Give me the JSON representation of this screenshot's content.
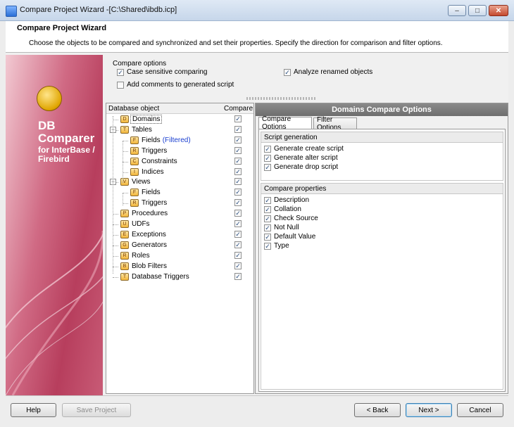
{
  "window": {
    "title": "Compare Project Wizard -[C:\\Shared\\ibdb.icp]",
    "controls": {
      "minimize": "–",
      "maximize": "□",
      "close": "✕"
    }
  },
  "header": {
    "title": "Compare Project Wizard",
    "description": "Choose the objects to be compared and synchronized and set their properties. Specify the direction for comparison and filter options."
  },
  "banner": {
    "product_line1": "DB",
    "product_line2": "Comparer",
    "product_sub": "for InterBase / Firebird",
    "logo_icon": "scales-icon"
  },
  "compare_options": {
    "legend": "Compare options",
    "case_sensitive": {
      "label": "Case sensitive comparing",
      "checked": true
    },
    "analyze_renamed": {
      "label": "Analyze renamed objects",
      "checked": true
    },
    "add_comments": {
      "label": "Add comments to generated script",
      "checked": false
    }
  },
  "tree": {
    "col_object": "Database object",
    "col_compare": "Compare",
    "nodes": [
      {
        "label": "Domains",
        "level": 0,
        "expander": "",
        "icon": "D",
        "selected": true,
        "checked": true
      },
      {
        "label": "Tables",
        "level": 0,
        "expander": "−",
        "icon": "T",
        "checked": true
      },
      {
        "label": "Fields",
        "suffix": "(Filtered)",
        "level": 1,
        "icon": "F",
        "checked": true
      },
      {
        "label": "Triggers",
        "level": 1,
        "icon": "R",
        "checked": true
      },
      {
        "label": "Constraints",
        "level": 1,
        "icon": "C",
        "checked": true
      },
      {
        "label": "Indices",
        "level": 1,
        "icon": "I",
        "checked": true
      },
      {
        "label": "Views",
        "level": 0,
        "expander": "−",
        "icon": "V",
        "checked": true
      },
      {
        "label": "Fields",
        "level": 1,
        "icon": "F",
        "checked": true
      },
      {
        "label": "Triggers",
        "level": 1,
        "icon": "R",
        "checked": true
      },
      {
        "label": "Procedures",
        "level": 0,
        "icon": "P",
        "checked": true
      },
      {
        "label": "UDFs",
        "level": 0,
        "icon": "U",
        "checked": true
      },
      {
        "label": "Exceptions",
        "level": 0,
        "icon": "E",
        "checked": true
      },
      {
        "label": "Generators",
        "level": 0,
        "icon": "G",
        "checked": true
      },
      {
        "label": "Roles",
        "level": 0,
        "icon": "R",
        "checked": true
      },
      {
        "label": "Blob Filters",
        "level": 0,
        "icon": "B",
        "checked": true
      },
      {
        "label": "Database Triggers",
        "level": 0,
        "icon": "T",
        "checked": true
      }
    ]
  },
  "options_panel": {
    "title": "Domains Compare Options",
    "tabs": [
      "Compare Options",
      "Filter Options"
    ],
    "active_tab": "Compare Options",
    "script_generation": {
      "header": "Script generation",
      "items": [
        {
          "label": "Generate create script",
          "checked": true
        },
        {
          "label": "Generate alter script",
          "checked": true
        },
        {
          "label": "Generate drop script",
          "checked": true
        }
      ]
    },
    "compare_properties": {
      "header": "Compare properties",
      "items": [
        {
          "label": "Description",
          "checked": true
        },
        {
          "label": "Collation",
          "checked": true
        },
        {
          "label": "Check Source",
          "checked": true
        },
        {
          "label": "Not Null",
          "checked": true
        },
        {
          "label": "Default Value",
          "checked": true
        },
        {
          "label": "Type",
          "checked": true
        }
      ]
    }
  },
  "buttons": {
    "help": "Help",
    "save_project": "Save Project",
    "back": "< Back",
    "next": "Next >",
    "cancel": "Cancel"
  },
  "check_mark": "✓"
}
